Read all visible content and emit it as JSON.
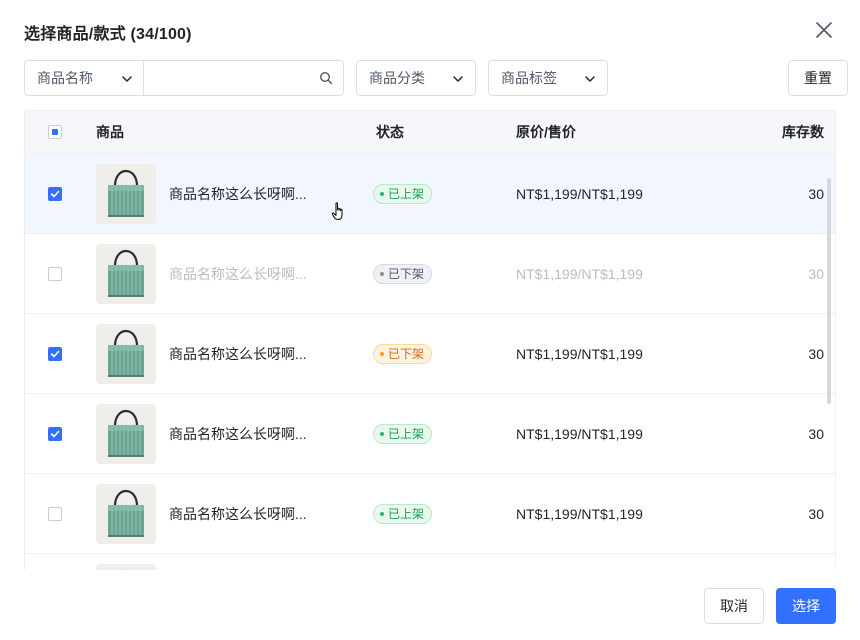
{
  "dialog": {
    "title": "选择商品/款式 (34/100)"
  },
  "filters": {
    "field_select": "商品名称",
    "search_placeholder": "",
    "category": "商品分类",
    "tag": "商品标签",
    "reset_label": "重置"
  },
  "table": {
    "columns": {
      "product": "商品",
      "status": "状态",
      "price": "原价/售价",
      "stock": "库存数"
    },
    "rows": [
      {
        "name": "商品名称这么长呀啊...",
        "status": "已上架",
        "status_color": "#2bb673",
        "price": "NT$1,199/NT$1,199",
        "stock": "30",
        "checked": true,
        "disabled": false
      },
      {
        "name": "商品名称这么长呀啊...",
        "status": "已下架",
        "status_color": "#86909c",
        "price": "NT$1,199/NT$1,199",
        "stock": "30",
        "checked": false,
        "disabled": true
      },
      {
        "name": "商品名称这么长呀啊...",
        "status": "已下架",
        "status_color": "#ff9a1f",
        "price": "NT$1,199/NT$1,199",
        "stock": "30",
        "checked": true,
        "disabled": false
      },
      {
        "name": "商品名称这么长呀啊...",
        "status": "已上架",
        "status_color": "#2bb673",
        "price": "NT$1,199/NT$1,199",
        "stock": "30",
        "checked": true,
        "disabled": false
      },
      {
        "name": "商品名称这么长呀啊...",
        "status": "已上架",
        "status_color": "#2bb673",
        "price": "NT$1,199/NT$1,199",
        "stock": "30",
        "checked": false,
        "disabled": false
      }
    ]
  },
  "footer": {
    "cancel_label": "取消",
    "select_label": "选择"
  },
  "colors": {
    "primary": "#3370ff",
    "row_hover": "#f2f6ff"
  },
  "icons": {
    "close": "close-icon",
    "search": "search-icon",
    "chevron": "chevron-down-icon",
    "cursor": "hand-pointer-icon"
  }
}
